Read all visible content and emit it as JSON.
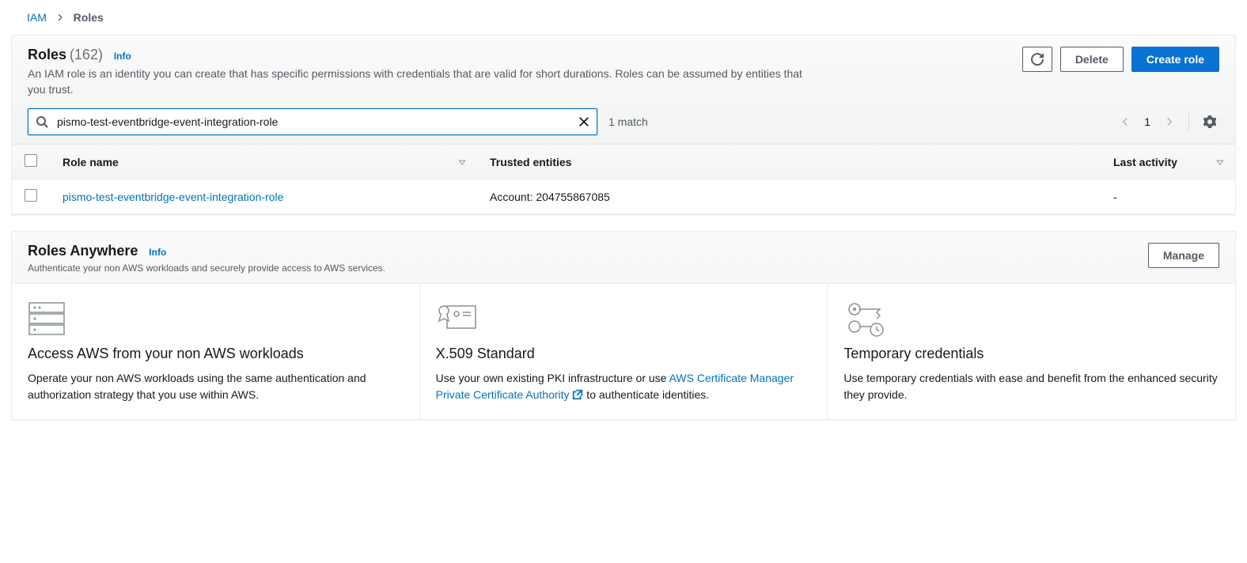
{
  "breadcrumb": {
    "root": "IAM",
    "current": "Roles"
  },
  "roles": {
    "title": "Roles",
    "count": "(162)",
    "info": "Info",
    "description": "An IAM role is an identity you can create that has specific permissions with credentials that are valid for short durations. Roles can be assumed by entities that you trust.",
    "actions": {
      "delete": "Delete",
      "create": "Create role"
    },
    "search": {
      "value": "pismo-test-eventbridge-event-integration-role",
      "match": "1 match"
    },
    "pager": {
      "page": "1"
    },
    "columns": {
      "role_name": "Role name",
      "trusted": "Trusted entities",
      "last": "Last activity"
    },
    "rows": [
      {
        "name": "pismo-test-eventbridge-event-integration-role",
        "trusted": "Account: 204755867085",
        "last": "-"
      }
    ]
  },
  "roles_anywhere": {
    "title": "Roles Anywhere",
    "info": "Info",
    "description": "Authenticate your non AWS workloads and securely provide access to AWS services.",
    "manage": "Manage",
    "cards": [
      {
        "title": "Access AWS from your non AWS workloads",
        "body_pre": "Operate your non AWS workloads using the same authentication and authorization strategy that you use within AWS.",
        "link": "",
        "body_post": ""
      },
      {
        "title": "X.509 Standard",
        "body_pre": "Use your own existing PKI infrastructure or use ",
        "link": "AWS Certificate Manager Private Certificate Authority",
        "body_post": " to authenticate identities."
      },
      {
        "title": "Temporary credentials",
        "body_pre": "Use temporary credentials with ease and benefit from the enhanced security they provide.",
        "link": "",
        "body_post": ""
      }
    ]
  }
}
